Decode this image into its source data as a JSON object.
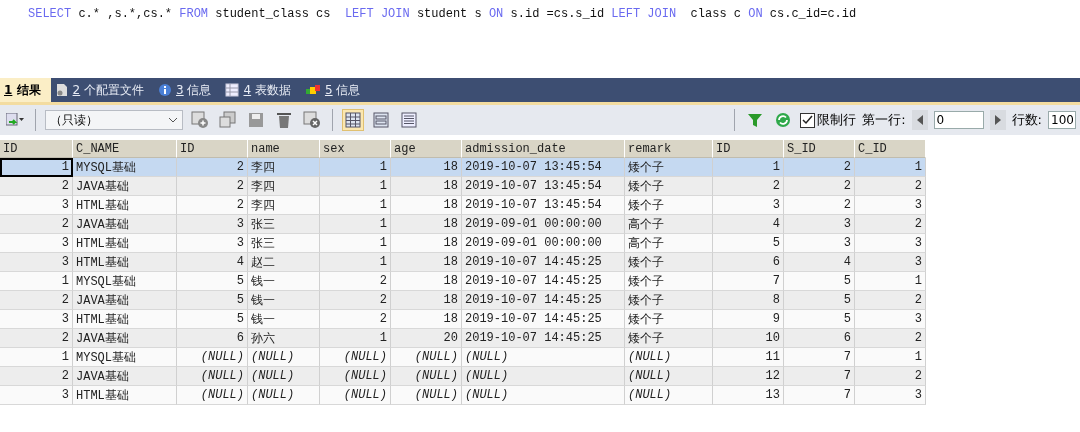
{
  "editor": {
    "sql": [
      {
        "text": "SELECT",
        "kind": "keyword"
      },
      {
        "text": " c.* ,s.*,cs.* ",
        "kind": "plain"
      },
      {
        "text": "FROM",
        "kind": "keyword"
      },
      {
        "text": " student_class cs  ",
        "kind": "plain"
      },
      {
        "text": "LEFT JOIN",
        "kind": "keyword"
      },
      {
        "text": " student s ",
        "kind": "plain"
      },
      {
        "text": "ON",
        "kind": "keyword"
      },
      {
        "text": " s.id =cs.s_id ",
        "kind": "plain"
      },
      {
        "text": "LEFT JOIN",
        "kind": "keyword"
      },
      {
        "text": "  class c ",
        "kind": "plain"
      },
      {
        "text": "ON",
        "kind": "keyword"
      },
      {
        "text": " cs.c_id=c.id",
        "kind": "plain"
      }
    ]
  },
  "tabs": [
    {
      "number": "1",
      "label": "结果",
      "kind": "result",
      "selected": true
    },
    {
      "number": "2",
      "label": "个配置文件",
      "kind": "profile",
      "selected": false
    },
    {
      "number": "3",
      "label": "信息",
      "kind": "info",
      "selected": false
    },
    {
      "number": "4",
      "label": "表数据",
      "kind": "table",
      "selected": false
    },
    {
      "number": "5",
      "label": "信息",
      "kind": "blocks",
      "selected": false
    }
  ],
  "toolbar": {
    "mode": "（只读）",
    "views": [
      {
        "kind": "grid",
        "selected": true
      },
      {
        "kind": "form",
        "selected": false
      },
      {
        "kind": "text",
        "selected": false
      }
    ],
    "limit_rows": {
      "label": "限制行",
      "checked": true
    },
    "first_row_label": "第一行:",
    "first_row": "0",
    "row_count_label": "行数:",
    "row_count": "100"
  },
  "table": {
    "columns": [
      {
        "label": "ID",
        "kind": "number"
      },
      {
        "label": "C_NAME",
        "kind": "text"
      },
      {
        "label": "ID",
        "kind": "number"
      },
      {
        "label": "name",
        "kind": "text"
      },
      {
        "label": "sex",
        "kind": "number"
      },
      {
        "label": "age",
        "kind": "number"
      },
      {
        "label": "admission_date",
        "kind": "text"
      },
      {
        "label": "remark",
        "kind": "text"
      },
      {
        "label": "ID",
        "kind": "number"
      },
      {
        "label": "S_ID",
        "kind": "number"
      },
      {
        "label": "C_ID",
        "kind": "number"
      }
    ],
    "rows": [
      {
        "selected": true,
        "cells": [
          "1",
          "MYSQL基础",
          "2",
          "李四",
          "1",
          "18",
          "2019-10-07 13:45:54",
          "矮个子",
          "1",
          "2",
          "1"
        ]
      },
      {
        "selected": false,
        "cells": [
          "2",
          "JAVA基础",
          "2",
          "李四",
          "1",
          "18",
          "2019-10-07 13:45:54",
          "矮个子",
          "2",
          "2",
          "2"
        ]
      },
      {
        "selected": false,
        "cells": [
          "3",
          "HTML基础",
          "2",
          "李四",
          "1",
          "18",
          "2019-10-07 13:45:54",
          "矮个子",
          "3",
          "2",
          "3"
        ]
      },
      {
        "selected": false,
        "cells": [
          "2",
          "JAVA基础",
          "3",
          "张三",
          "1",
          "18",
          "2019-09-01 00:00:00",
          "高个子",
          "4",
          "3",
          "2"
        ]
      },
      {
        "selected": false,
        "cells": [
          "3",
          "HTML基础",
          "3",
          "张三",
          "1",
          "18",
          "2019-09-01 00:00:00",
          "高个子",
          "5",
          "3",
          "3"
        ]
      },
      {
        "selected": false,
        "cells": [
          "3",
          "HTML基础",
          "4",
          "赵二",
          "1",
          "18",
          "2019-10-07 14:45:25",
          "矮个子",
          "6",
          "4",
          "3"
        ]
      },
      {
        "selected": false,
        "cells": [
          "1",
          "MYSQL基础",
          "5",
          "钱一",
          "2",
          "18",
          "2019-10-07 14:45:25",
          "矮个子",
          "7",
          "5",
          "1"
        ]
      },
      {
        "selected": false,
        "cells": [
          "2",
          "JAVA基础",
          "5",
          "钱一",
          "2",
          "18",
          "2019-10-07 14:45:25",
          "矮个子",
          "8",
          "5",
          "2"
        ]
      },
      {
        "selected": false,
        "cells": [
          "3",
          "HTML基础",
          "5",
          "钱一",
          "2",
          "18",
          "2019-10-07 14:45:25",
          "矮个子",
          "9",
          "5",
          "3"
        ]
      },
      {
        "selected": false,
        "cells": [
          "2",
          "JAVA基础",
          "6",
          "孙六",
          "1",
          "20",
          "2019-10-07 14:45:25",
          "矮个子",
          "10",
          "6",
          "2"
        ]
      },
      {
        "selected": false,
        "cells": [
          "1",
          "MYSQL基础",
          {
            "text": "(NULL)",
            "null": true
          },
          {
            "text": "(NULL)",
            "null": true
          },
          {
            "text": "(NULL)",
            "null": true
          },
          {
            "text": "(NULL)",
            "null": true
          },
          {
            "text": "(NULL)",
            "null": true
          },
          {
            "text": "(NULL)",
            "null": true
          },
          "11",
          "7",
          "1"
        ]
      },
      {
        "selected": false,
        "cells": [
          "2",
          "JAVA基础",
          {
            "text": "(NULL)",
            "null": true
          },
          {
            "text": "(NULL)",
            "null": true
          },
          {
            "text": "(NULL)",
            "null": true
          },
          {
            "text": "(NULL)",
            "null": true
          },
          {
            "text": "(NULL)",
            "null": true
          },
          {
            "text": "(NULL)",
            "null": true
          },
          "12",
          "7",
          "2"
        ]
      },
      {
        "selected": false,
        "cells": [
          "3",
          "HTML基础",
          {
            "text": "(NULL)",
            "null": true
          },
          {
            "text": "(NULL)",
            "null": true
          },
          {
            "text": "(NULL)",
            "null": true
          },
          {
            "text": "(NULL)",
            "null": true
          },
          {
            "text": "(NULL)",
            "null": true
          },
          {
            "text": "(NULL)",
            "null": true
          },
          "13",
          "7",
          "3"
        ]
      }
    ]
  }
}
